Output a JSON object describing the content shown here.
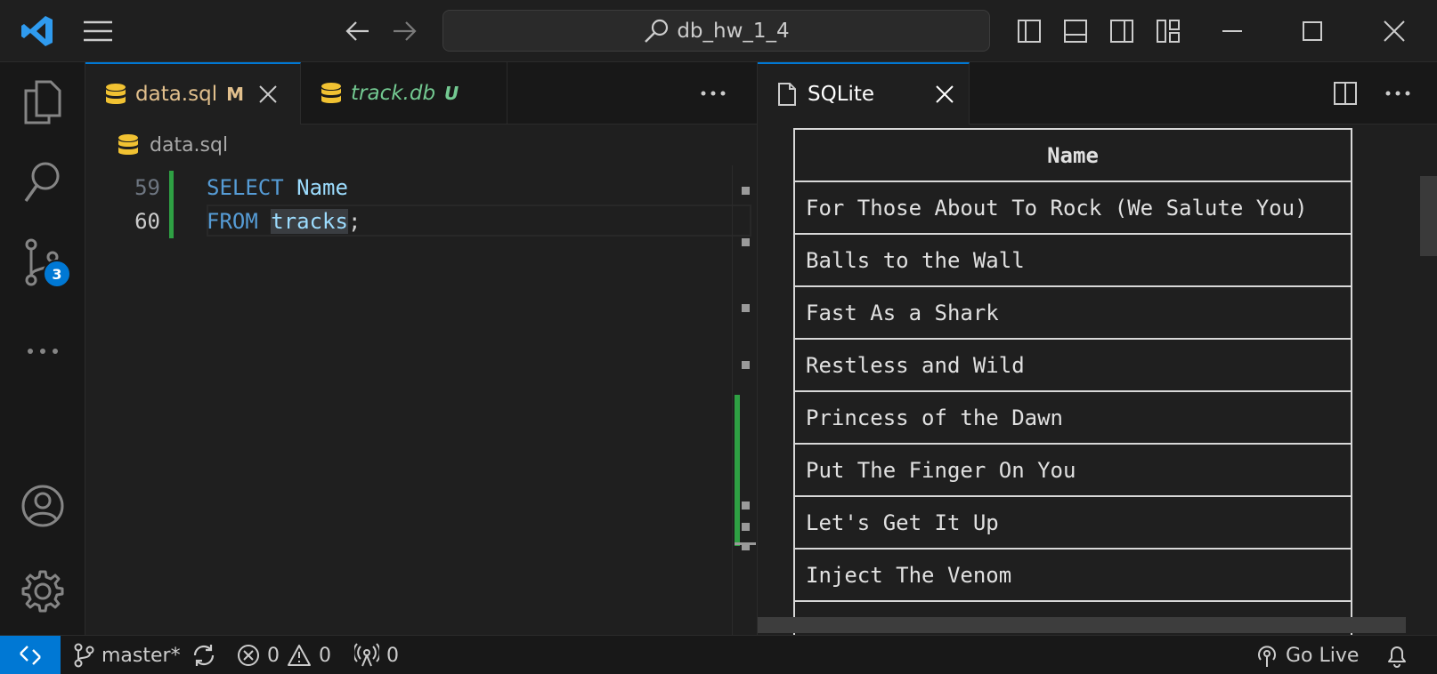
{
  "titlebar": {
    "search_text": "db_hw_1_4"
  },
  "activity": {
    "scm_badge": "3"
  },
  "tabs_left": [
    {
      "label": "data.sql",
      "status": "M"
    },
    {
      "label": "track.db",
      "status": "U"
    }
  ],
  "breadcrumb": {
    "file": "data.sql"
  },
  "editor": {
    "lines": [
      {
        "number": "59",
        "keyword": "SELECT",
        "rest": "Name",
        "end": ""
      },
      {
        "number": "60",
        "keyword": "FROM",
        "rest": "tracks",
        "end": ";"
      }
    ]
  },
  "tabs_right": {
    "label": "SQLite"
  },
  "result": {
    "header": "Name",
    "rows": [
      "For Those About To Rock (We Salute You)",
      "Balls to the Wall",
      "Fast As a Shark",
      "Restless and Wild",
      "Princess of the Dawn",
      "Put The Finger On You",
      "Let's Get It Up",
      "Inject The Venom",
      ""
    ]
  },
  "statusbar": {
    "branch": "master*",
    "errors": "0",
    "warnings": "0",
    "ports": "0",
    "go_live": "Go Live"
  },
  "colors": {
    "accent": "#0078d4",
    "git_added": "#2ea043",
    "modified": "#d7ba7d",
    "untracked": "#73c991"
  }
}
